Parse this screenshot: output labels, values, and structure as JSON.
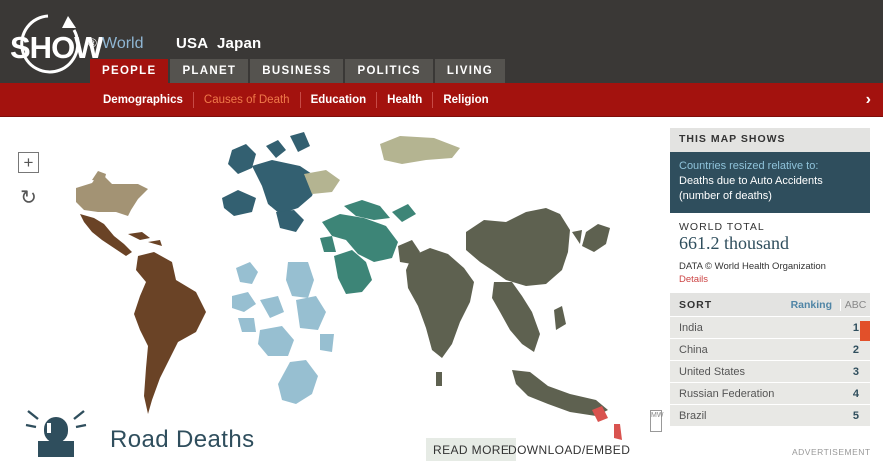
{
  "brand": {
    "logo_text": "SHOW",
    "reg": "®",
    "world": "World"
  },
  "country_links": [
    "USA",
    "Japan"
  ],
  "main_tabs": [
    "PEOPLE",
    "PLANET",
    "BUSINESS",
    "POLITICS",
    "LIVING"
  ],
  "sub_tabs": [
    "Demographics",
    "Causes of Death",
    "Education",
    "Health",
    "Religion"
  ],
  "subnav_arrow": "›",
  "map": {
    "zoom_icon": "+",
    "reset_icon": "↻",
    "mw_label": "MW",
    "title": "Road Deaths",
    "read_more": "READ MORE",
    "download": "DOWNLOAD/EMBED"
  },
  "panel": {
    "heading": "THIS MAP SHOWS",
    "desc_label": "Countries resized relative to:",
    "desc_text": "Deaths due to Auto Accidents (number of deaths)",
    "world_total_label": "WORLD TOTAL",
    "world_total_value": "661.2 thousand",
    "source": "DATA © World Health Organization",
    "details": "Details",
    "sort_label": "SORT",
    "sort_ranking": "Ranking",
    "sort_abc": "ABC",
    "rows": [
      {
        "name": "India",
        "rank": "1"
      },
      {
        "name": "China",
        "rank": "2"
      },
      {
        "name": "United States",
        "rank": "3"
      },
      {
        "name": "Russian Federation",
        "rank": "4"
      },
      {
        "name": "Brazil",
        "rank": "5"
      }
    ]
  },
  "advertisement": "ADVERTISEMENT",
  "colors": {
    "header_bg": "#3a3836",
    "accent_red": "#a3120e",
    "panel_blue": "#2f4e5d",
    "americas_north": "#a39374",
    "americas_latin": "#6a4326",
    "europe": "#336071",
    "middle_east": "#3d8577",
    "africa": "#97bfd1",
    "asia": "#5e6150",
    "russia": "#b4b491",
    "oceania": "#d9534f"
  }
}
